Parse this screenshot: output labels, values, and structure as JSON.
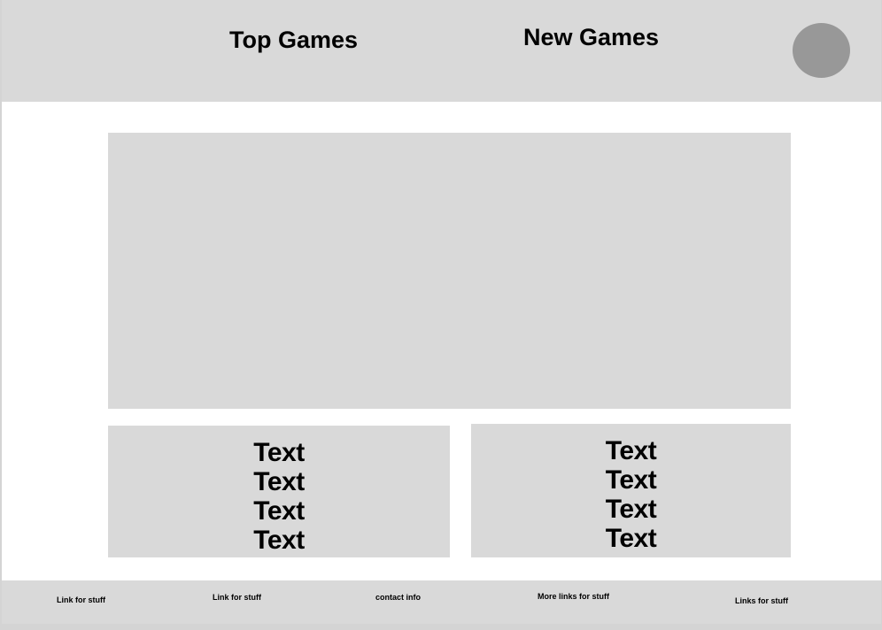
{
  "header": {
    "nav": {
      "top_games": "Top Games",
      "new_games": "New Games"
    }
  },
  "colors": {
    "panel": "#d9d9d9",
    "avatar": "#989898",
    "background": "#ffffff"
  },
  "cards": {
    "left": {
      "lines": [
        "Text",
        "Text",
        "Text",
        "Text"
      ]
    },
    "right": {
      "lines": [
        "Text",
        "Text",
        "Text",
        "Text"
      ]
    }
  },
  "footer": {
    "links": [
      "Link for stuff",
      "Link for stuff",
      "contact info",
      "More links for stuff",
      "Links for stuff"
    ]
  }
}
